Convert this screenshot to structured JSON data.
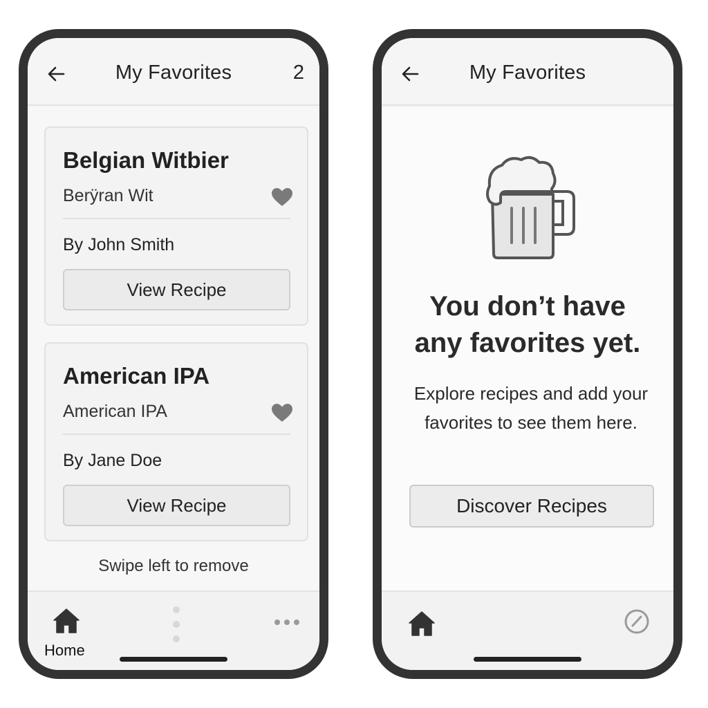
{
  "left_screen": {
    "header": {
      "back_icon": "arrow-left-icon",
      "title": "My Favorites",
      "count": "2"
    },
    "favorites": [
      {
        "name": "Belgian Witbier",
        "style": "Berÿran Wit",
        "author": "By John Smith",
        "button_label": "View Recipe",
        "icon": "heart-icon"
      },
      {
        "name": "American IPA",
        "style": "American IPA",
        "author": "By Jane Doe",
        "button_label": "View Recipe",
        "icon": "heart-icon"
      }
    ],
    "swipe_hint": "Swipe left to remove",
    "bottom_nav": {
      "home_label": "Home",
      "home_icon": "home-icon",
      "center_icon": "vertical-dots-icon",
      "more_icon": "more-horizontal-icon"
    }
  },
  "right_screen": {
    "header": {
      "back_icon": "arrow-left-icon",
      "title": "My Favorites"
    },
    "empty_state": {
      "icon": "beer-mug-icon",
      "title_line1": "You don’t have",
      "title_line2": "any favorites yet.",
      "body": "Explore recipes and add your favorites to see them here.",
      "button_label": "Discover Recipes"
    },
    "bottom_nav": {
      "home_icon": "home-icon",
      "right_icon": "compass-icon"
    }
  },
  "colors": {
    "frame": "#333333",
    "screen_bg": "#f5f5f5",
    "card_bg": "#f3f3f3",
    "heart": "#777777",
    "button_bg": "#ebebeb"
  }
}
